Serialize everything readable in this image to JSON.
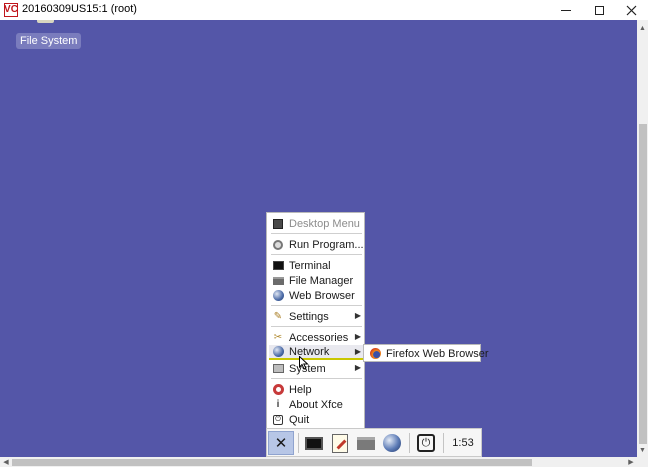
{
  "window": {
    "app_icon": "VC",
    "title": "20160309US15:1 (root)",
    "controls": [
      "minimize",
      "maximize",
      "close"
    ]
  },
  "desktop": {
    "background_color": "#5456a8",
    "icons": [
      {
        "label": "File System",
        "icon": "drive-icon"
      }
    ]
  },
  "menu": {
    "header": "Desktop Menu",
    "items": [
      {
        "label": "Run Program...",
        "icon": "run-icon"
      },
      {
        "label": "Terminal",
        "icon": "terminal-icon"
      },
      {
        "label": "File Manager",
        "icon": "file-manager-icon"
      },
      {
        "label": "Web Browser",
        "icon": "web-browser-icon"
      },
      {
        "label": "Settings",
        "icon": "settings-icon",
        "submenu": true
      },
      {
        "label": "Accessories",
        "icon": "accessories-icon",
        "submenu": true
      },
      {
        "label": "Network",
        "icon": "network-icon",
        "submenu": true,
        "active": true
      },
      {
        "label": "System",
        "icon": "system-icon",
        "submenu": true
      },
      {
        "label": "Help",
        "icon": "help-icon"
      },
      {
        "label": "About Xfce",
        "icon": "about-icon"
      },
      {
        "label": "Quit",
        "icon": "quit-icon"
      }
    ]
  },
  "submenu": {
    "items": [
      {
        "label": "Firefox Web Browser",
        "icon": "firefox-icon"
      }
    ]
  },
  "panel": {
    "launchers": [
      "xfce-menu-icon",
      "terminal-icon",
      "text-editor-icon",
      "file-manager-icon",
      "web-browser-icon",
      "power-icon"
    ],
    "clock": "1:53"
  }
}
